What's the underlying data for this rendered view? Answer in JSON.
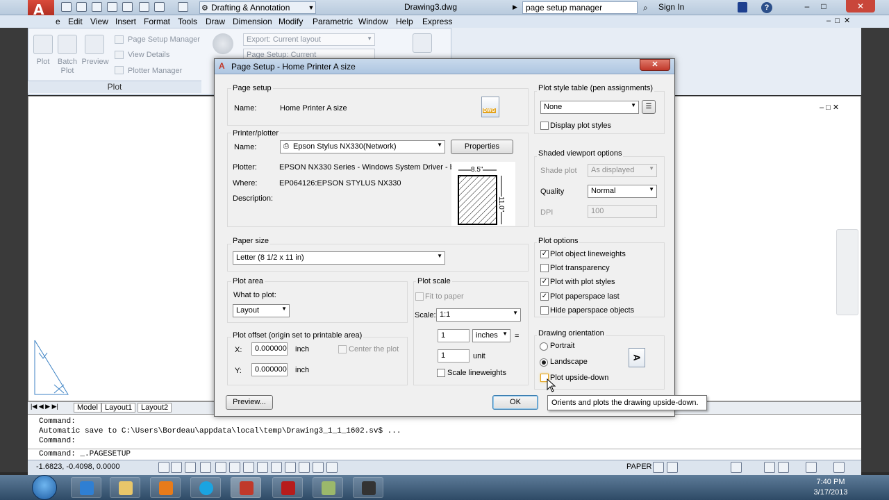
{
  "titlebar": {
    "workspace": "Drafting & Annotation",
    "document": "Drawing3.dwg",
    "search_value": "page setup manager",
    "signin": "Sign In",
    "help": "?",
    "close": "✕"
  },
  "menubar": [
    "e",
    "Edit",
    "View",
    "Insert",
    "Format",
    "Tools",
    "Draw",
    "Dimension",
    "Modify",
    "Parametric",
    "Window",
    "Help",
    "Express"
  ],
  "ribbon": {
    "plot": "Plot",
    "batch_plot": "Batch Plot",
    "preview": "Preview",
    "page_setup_manager": "Page Setup Manager",
    "view_details": "View Details",
    "plotter_manager": "Plotter Manager",
    "export": "Export: Current layout",
    "page_setup": "Page Setup: Current",
    "panel_label": "Plot"
  },
  "layout_tabs": [
    "Model",
    "Layout1",
    "Layout2"
  ],
  "command": {
    "line1": "Command:",
    "line2": "Automatic save to C:\\Users\\Bordeau\\appdata\\local\\temp\\Drawing3_1_1_1602.sv$ ...",
    "line3": "Command:",
    "input": "Command:  _.PAGESETUP"
  },
  "status": {
    "coords": "-1.6823, -0.4098, 0.0000",
    "paper": "PAPER"
  },
  "clock": {
    "time": "7:40 PM",
    "date": "3/17/2013"
  },
  "dialog": {
    "title": "Page Setup - Home Printer  A size",
    "page_setup": {
      "heading": "Page setup",
      "name_label": "Name:",
      "name_value": "Home Printer  A size",
      "dwg_icon_text": "DWG"
    },
    "printer": {
      "heading": "Printer/plotter",
      "name_label": "Name:",
      "name_value": "Epson Stylus NX330(Network)",
      "properties": "Properties",
      "plotter_label": "Plotter:",
      "plotter_value": "EPSON NX330 Series - Windows System Driver - by...",
      "where_label": "Where:",
      "where_value": "EP064126:EPSON STYLUS NX330",
      "description_label": "Description:",
      "paper_width": "8.5\"",
      "paper_height": "11.0\""
    },
    "paper_size": {
      "heading": "Paper size",
      "value": "Letter (8 1/2 x 11 in)"
    },
    "plot_area": {
      "heading": "Plot area",
      "what_label": "What to plot:",
      "value": "Layout"
    },
    "plot_offset": {
      "heading": "Plot offset (origin set to printable area)",
      "x_label": "X:",
      "x_value": "0.000000",
      "x_unit": "inch",
      "y_label": "Y:",
      "y_value": "0.000000",
      "y_unit": "inch",
      "center_label": "Center the plot"
    },
    "plot_scale": {
      "heading": "Plot scale",
      "fit_label": "Fit to paper",
      "scale_label": "Scale:",
      "scale_value": "1:1",
      "value1": "1",
      "unit1": "inches",
      "equals": "=",
      "value2": "1",
      "unit2": "unit",
      "lineweights_label": "Scale lineweights"
    },
    "plot_style": {
      "heading": "Plot style table (pen assignments)",
      "value": "None",
      "display_label": "Display plot styles"
    },
    "shaded": {
      "heading": "Shaded viewport options",
      "shade_label": "Shade plot",
      "shade_value": "As displayed",
      "quality_label": "Quality",
      "quality_value": "Normal",
      "dpi_label": "DPI",
      "dpi_value": "100"
    },
    "plot_options": {
      "heading": "Plot options",
      "items": [
        {
          "label": "Plot object lineweights",
          "checked": "✓"
        },
        {
          "label": "Plot transparency",
          "checked": ""
        },
        {
          "label": "Plot with plot styles",
          "checked": "✓"
        },
        {
          "label": "Plot paperspace last",
          "checked": "✓"
        },
        {
          "label": "Hide paperspace objects",
          "checked": ""
        }
      ]
    },
    "orientation": {
      "heading": "Drawing orientation",
      "portrait": "Portrait",
      "landscape": "Landscape",
      "upside_down": "Plot upside-down",
      "icon_text": "A"
    },
    "preview_button": "Preview...",
    "ok_button": "OK"
  },
  "tooltip": "Orients and plots the drawing upside-down."
}
